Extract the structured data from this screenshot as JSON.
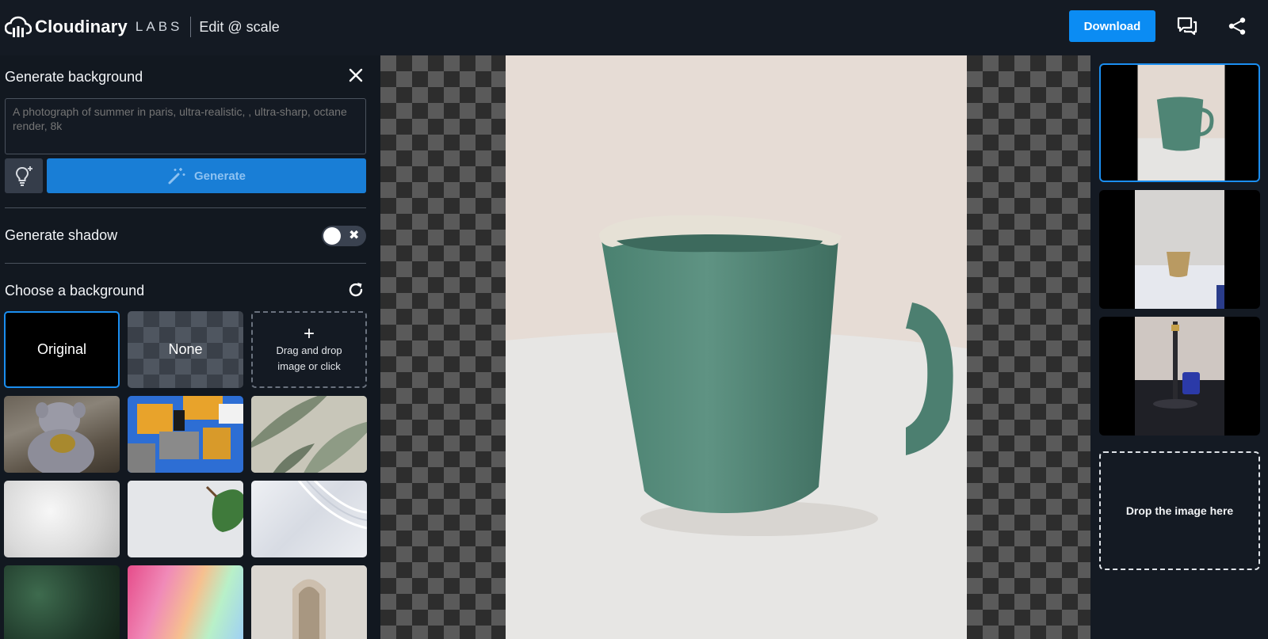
{
  "header": {
    "brand_name": "Cloudinary",
    "brand_labs": "LABS",
    "brand_edit": "Edit @ scale",
    "download_label": "Download",
    "icons": [
      "cloud-logo-icon",
      "chat-icon",
      "share-icon"
    ],
    "accent_color": "#0b8cf3"
  },
  "left_panel": {
    "generate_background": {
      "title": "Generate background",
      "prompt_placeholder": "A photograph of summer in paris, ultra-realistic, , ultra-sharp, octane render, 8k",
      "prompt_value": "",
      "generate_label": "Generate"
    },
    "generate_shadow": {
      "title": "Generate shadow",
      "toggle_on": false,
      "toggle_off_glyph": "✖"
    },
    "choose_background": {
      "title": "Choose a background",
      "original_label": "Original",
      "none_label": "None",
      "upload_plus": "+",
      "upload_label": "Drag and drop image or click",
      "preset_tiles": [
        "teddy-bear",
        "abstract-paint",
        "tropical-leaves",
        "white-silk",
        "monstera-wall",
        "white-waves",
        "green-foliage",
        "rainbow-gradient",
        "arch-pedestal"
      ]
    }
  },
  "right_panel": {
    "thumbnails": [
      "green-mug",
      "tan-cup",
      "blue-mug-lamp"
    ],
    "selected_index": 0,
    "drop_label": "Drop the image here"
  }
}
